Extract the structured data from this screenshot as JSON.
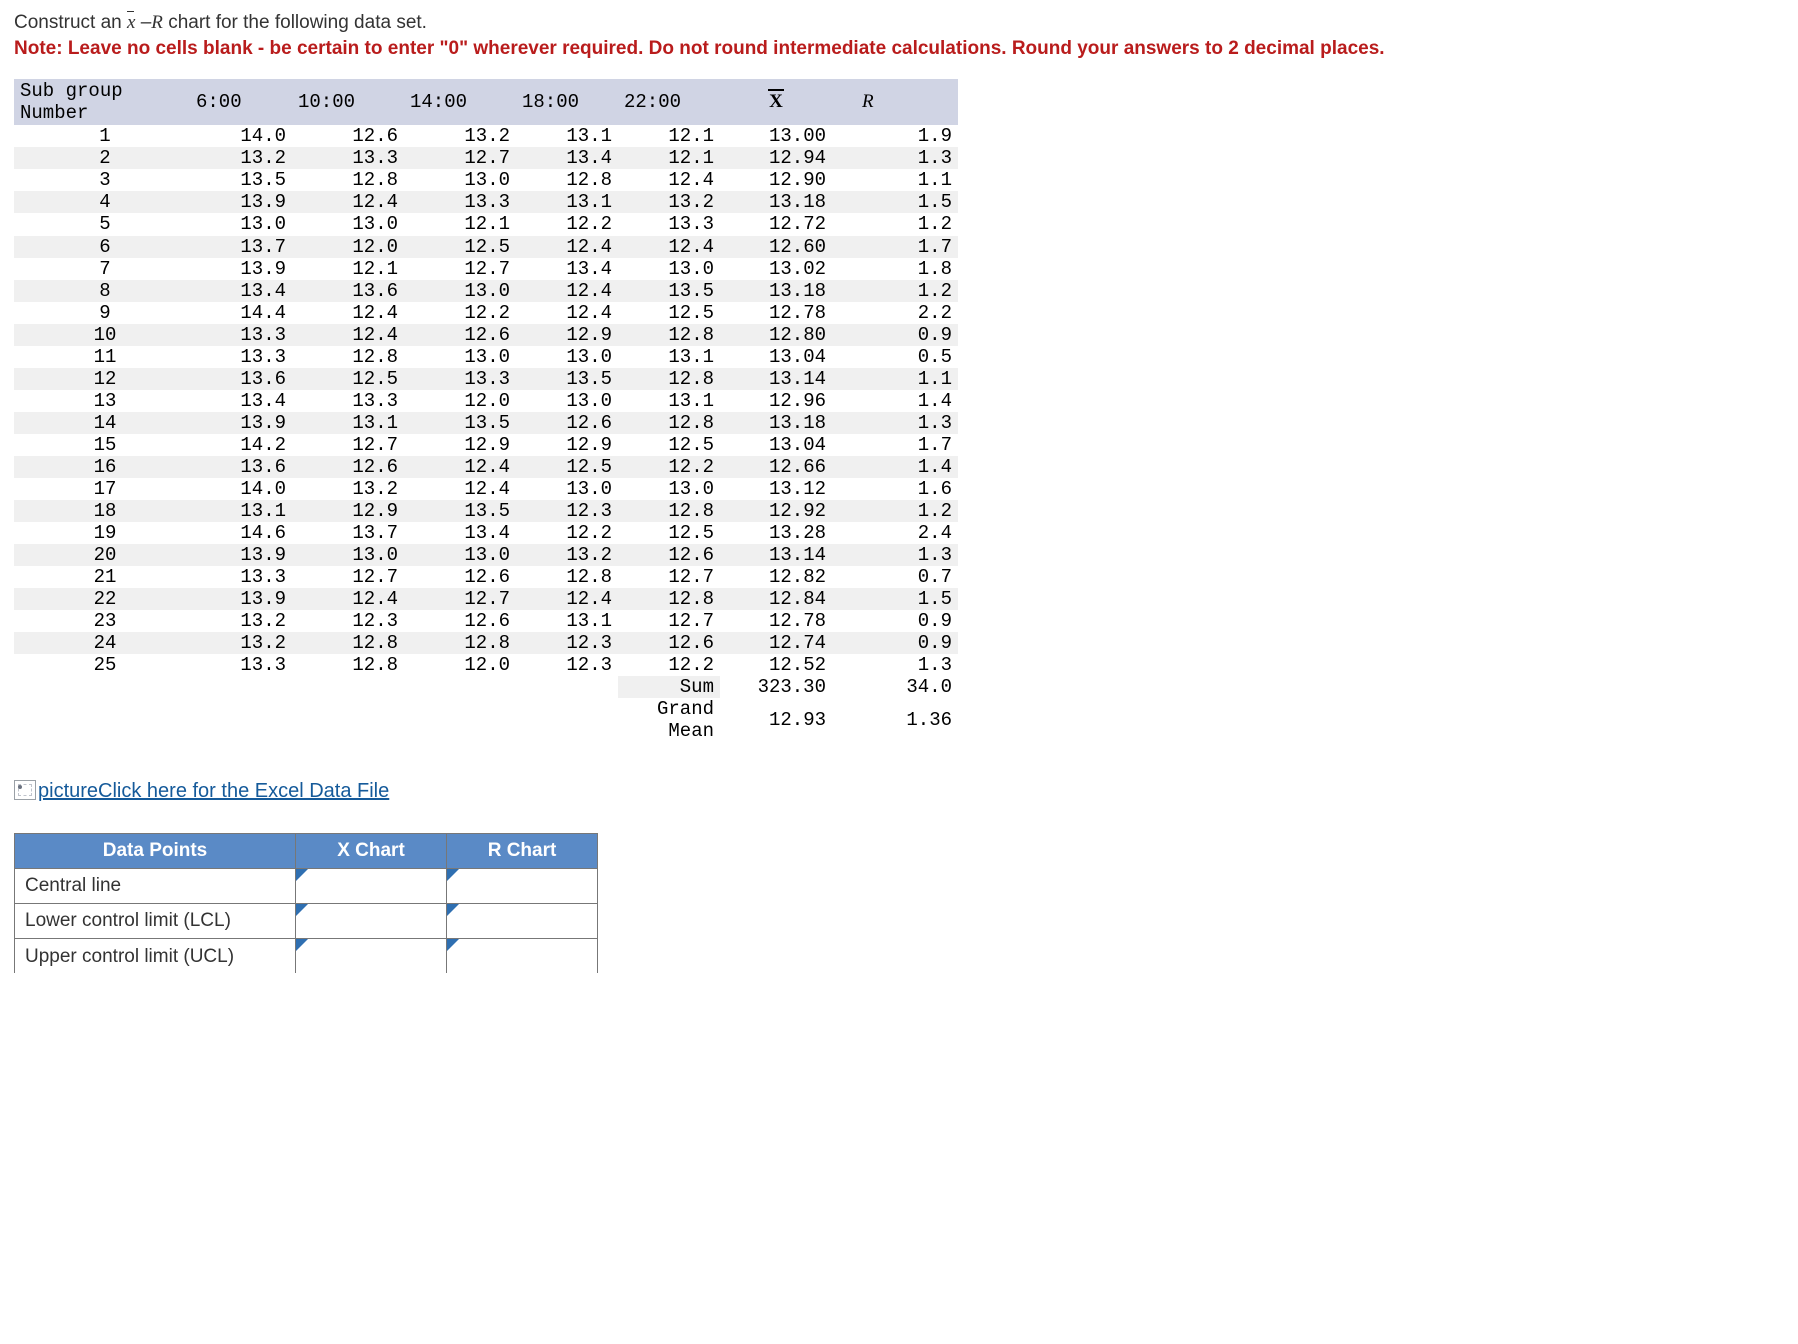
{
  "prompt": {
    "part1": "Construct an ",
    "xbar": "x",
    "part2": " –",
    "R": "R",
    "part3": " chart for the following data set.",
    "note": "Note: Leave no cells blank - be certain to enter \"0\" wherever required. Do not round intermediate calculations. Round your answers to 2 decimal places."
  },
  "table": {
    "headers": {
      "subgroup": "Sub group Number",
      "t6": "6:00",
      "t10": "10:00",
      "t14": "14:00",
      "t18": "18:00",
      "t22": "22:00",
      "xbar": "X",
      "R": "R"
    },
    "rows": [
      {
        "n": "1",
        "t6": "14.0",
        "t10": "12.6",
        "t14": "13.2",
        "t18": "13.1",
        "t22": "12.1",
        "xbar": "13.00",
        "R": "1.9"
      },
      {
        "n": "2",
        "t6": "13.2",
        "t10": "13.3",
        "t14": "12.7",
        "t18": "13.4",
        "t22": "12.1",
        "xbar": "12.94",
        "R": "1.3"
      },
      {
        "n": "3",
        "t6": "13.5",
        "t10": "12.8",
        "t14": "13.0",
        "t18": "12.8",
        "t22": "12.4",
        "xbar": "12.90",
        "R": "1.1"
      },
      {
        "n": "4",
        "t6": "13.9",
        "t10": "12.4",
        "t14": "13.3",
        "t18": "13.1",
        "t22": "13.2",
        "xbar": "13.18",
        "R": "1.5"
      },
      {
        "n": "5",
        "t6": "13.0",
        "t10": "13.0",
        "t14": "12.1",
        "t18": "12.2",
        "t22": "13.3",
        "xbar": "12.72",
        "R": "1.2"
      },
      {
        "n": "6",
        "t6": "13.7",
        "t10": "12.0",
        "t14": "12.5",
        "t18": "12.4",
        "t22": "12.4",
        "xbar": "12.60",
        "R": "1.7"
      },
      {
        "n": "7",
        "t6": "13.9",
        "t10": "12.1",
        "t14": "12.7",
        "t18": "13.4",
        "t22": "13.0",
        "xbar": "13.02",
        "R": "1.8"
      },
      {
        "n": "8",
        "t6": "13.4",
        "t10": "13.6",
        "t14": "13.0",
        "t18": "12.4",
        "t22": "13.5",
        "xbar": "13.18",
        "R": "1.2"
      },
      {
        "n": "9",
        "t6": "14.4",
        "t10": "12.4",
        "t14": "12.2",
        "t18": "12.4",
        "t22": "12.5",
        "xbar": "12.78",
        "R": "2.2"
      },
      {
        "n": "10",
        "t6": "13.3",
        "t10": "12.4",
        "t14": "12.6",
        "t18": "12.9",
        "t22": "12.8",
        "xbar": "12.80",
        "R": "0.9"
      },
      {
        "n": "11",
        "t6": "13.3",
        "t10": "12.8",
        "t14": "13.0",
        "t18": "13.0",
        "t22": "13.1",
        "xbar": "13.04",
        "R": "0.5"
      },
      {
        "n": "12",
        "t6": "13.6",
        "t10": "12.5",
        "t14": "13.3",
        "t18": "13.5",
        "t22": "12.8",
        "xbar": "13.14",
        "R": "1.1"
      },
      {
        "n": "13",
        "t6": "13.4",
        "t10": "13.3",
        "t14": "12.0",
        "t18": "13.0",
        "t22": "13.1",
        "xbar": "12.96",
        "R": "1.4"
      },
      {
        "n": "14",
        "t6": "13.9",
        "t10": "13.1",
        "t14": "13.5",
        "t18": "12.6",
        "t22": "12.8",
        "xbar": "13.18",
        "R": "1.3"
      },
      {
        "n": "15",
        "t6": "14.2",
        "t10": "12.7",
        "t14": "12.9",
        "t18": "12.9",
        "t22": "12.5",
        "xbar": "13.04",
        "R": "1.7"
      },
      {
        "n": "16",
        "t6": "13.6",
        "t10": "12.6",
        "t14": "12.4",
        "t18": "12.5",
        "t22": "12.2",
        "xbar": "12.66",
        "R": "1.4"
      },
      {
        "n": "17",
        "t6": "14.0",
        "t10": "13.2",
        "t14": "12.4",
        "t18": "13.0",
        "t22": "13.0",
        "xbar": "13.12",
        "R": "1.6"
      },
      {
        "n": "18",
        "t6": "13.1",
        "t10": "12.9",
        "t14": "13.5",
        "t18": "12.3",
        "t22": "12.8",
        "xbar": "12.92",
        "R": "1.2"
      },
      {
        "n": "19",
        "t6": "14.6",
        "t10": "13.7",
        "t14": "13.4",
        "t18": "12.2",
        "t22": "12.5",
        "xbar": "13.28",
        "R": "2.4"
      },
      {
        "n": "20",
        "t6": "13.9",
        "t10": "13.0",
        "t14": "13.0",
        "t18": "13.2",
        "t22": "12.6",
        "xbar": "13.14",
        "R": "1.3"
      },
      {
        "n": "21",
        "t6": "13.3",
        "t10": "12.7",
        "t14": "12.6",
        "t18": "12.8",
        "t22": "12.7",
        "xbar": "12.82",
        "R": "0.7"
      },
      {
        "n": "22",
        "t6": "13.9",
        "t10": "12.4",
        "t14": "12.7",
        "t18": "12.4",
        "t22": "12.8",
        "xbar": "12.84",
        "R": "1.5"
      },
      {
        "n": "23",
        "t6": "13.2",
        "t10": "12.3",
        "t14": "12.6",
        "t18": "13.1",
        "t22": "12.7",
        "xbar": "12.78",
        "R": "0.9"
      },
      {
        "n": "24",
        "t6": "13.2",
        "t10": "12.8",
        "t14": "12.8",
        "t18": "12.3",
        "t22": "12.6",
        "xbar": "12.74",
        "R": "0.9"
      },
      {
        "n": "25",
        "t6": "13.3",
        "t10": "12.8",
        "t14": "12.0",
        "t18": "12.3",
        "t22": "12.2",
        "xbar": "12.52",
        "R": "1.3"
      }
    ],
    "footer": {
      "sum_label": "Sum",
      "sum_xbar": "323.30",
      "sum_R": "34.0",
      "grandmean_label": "Grand Mean",
      "gm_xbar": "12.93",
      "gm_R": "1.36"
    }
  },
  "excel_link": {
    "prefix": "picture",
    "text": "Click here for the Excel Data File"
  },
  "answer": {
    "headers": {
      "datapoints": "Data Points",
      "xchart": "X Chart",
      "rchart": "R Chart"
    },
    "rows": [
      "Central line",
      "Lower control limit (LCL)",
      "Upper control limit (UCL)"
    ]
  }
}
